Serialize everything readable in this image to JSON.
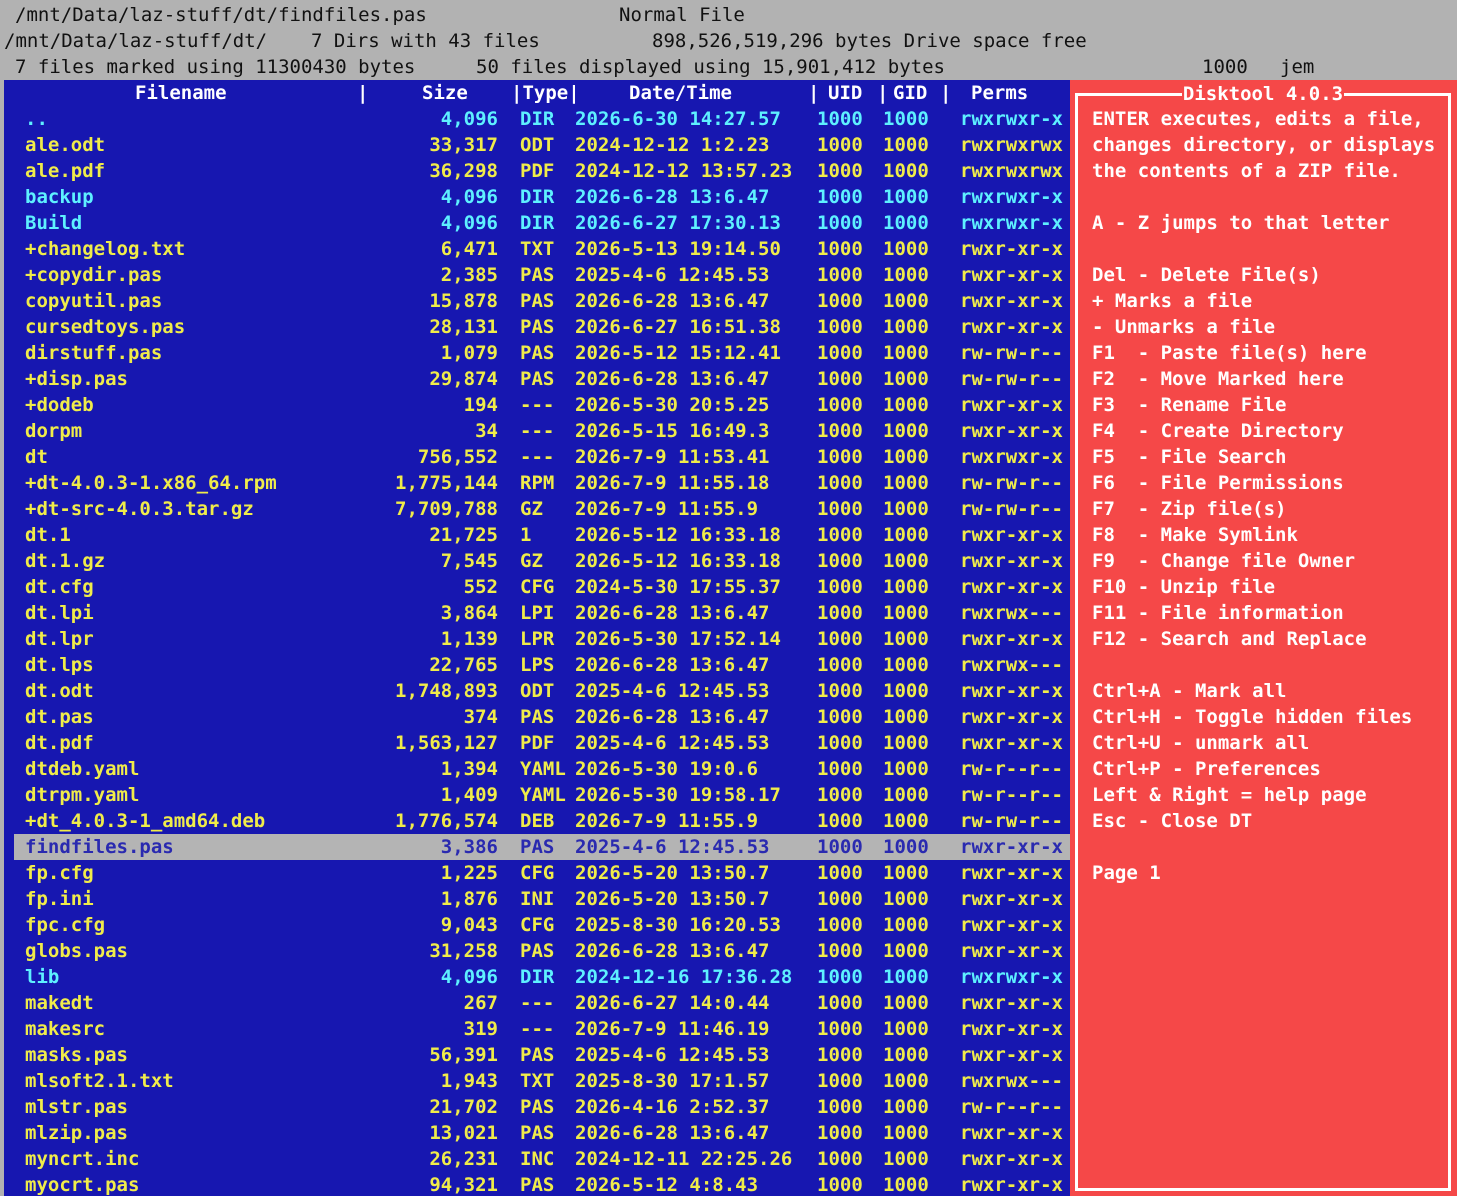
{
  "status": {
    "line1_path": "/mnt/Data/laz-stuff/dt/findfiles.pas",
    "line1_kind": "Normal File",
    "line2_dir": "/mnt/Data/laz-stuff/dt/",
    "line2_counts": "7 Dirs with 43 files",
    "line2_free": "898,526,519,296 bytes Drive space free",
    "line3_marked": "7 files marked using 11300430 bytes",
    "line3_displayed": "50 files displayed using 15,901,412 bytes",
    "line3_uid": "1000",
    "line3_user": "jem"
  },
  "columns": {
    "filename": "Filename",
    "sep1": "|",
    "size": "Size",
    "type": "|Type|",
    "datetime": "Date/Time",
    "sep2": "|",
    "uid": "UID",
    "sep3": "|",
    "gid": "GID",
    "sep4": "|",
    "perms": "Perms"
  },
  "files": [
    {
      "name": "..",
      "size": "4,096",
      "type": "DIR",
      "date": "2026-6-30 14:27.57",
      "uid": "1000",
      "gid": "1000",
      "perms": "rwxrwxr-x",
      "kind": "dir"
    },
    {
      "name": "ale.odt",
      "size": "33,317",
      "type": "ODT",
      "date": "2024-12-12 1:2.23",
      "uid": "1000",
      "gid": "1000",
      "perms": "rwxrwxrwx",
      "kind": "file"
    },
    {
      "name": "ale.pdf",
      "size": "36,298",
      "type": "PDF",
      "date": "2024-12-12 13:57.23",
      "uid": "1000",
      "gid": "1000",
      "perms": "rwxrwxrwx",
      "kind": "file"
    },
    {
      "name": "backup",
      "size": "4,096",
      "type": "DIR",
      "date": "2026-6-28 13:6.47",
      "uid": "1000",
      "gid": "1000",
      "perms": "rwxrwxr-x",
      "kind": "dir"
    },
    {
      "name": "Build",
      "size": "4,096",
      "type": "DIR",
      "date": "2026-6-27 17:30.13",
      "uid": "1000",
      "gid": "1000",
      "perms": "rwxrwxr-x",
      "kind": "dir"
    },
    {
      "name": "+changelog.txt",
      "size": "6,471",
      "type": "TXT",
      "date": "2026-5-13 19:14.50",
      "uid": "1000",
      "gid": "1000",
      "perms": "rwxr-xr-x",
      "kind": "file"
    },
    {
      "name": "+copydir.pas",
      "size": "2,385",
      "type": "PAS",
      "date": "2025-4-6 12:45.53",
      "uid": "1000",
      "gid": "1000",
      "perms": "rwxr-xr-x",
      "kind": "file"
    },
    {
      "name": "copyutil.pas",
      "size": "15,878",
      "type": "PAS",
      "date": "2026-6-28 13:6.47",
      "uid": "1000",
      "gid": "1000",
      "perms": "rwxr-xr-x",
      "kind": "file"
    },
    {
      "name": "cursedtoys.pas",
      "size": "28,131",
      "type": "PAS",
      "date": "2026-6-27 16:51.38",
      "uid": "1000",
      "gid": "1000",
      "perms": "rwxr-xr-x",
      "kind": "file"
    },
    {
      "name": "dirstuff.pas",
      "size": "1,079",
      "type": "PAS",
      "date": "2026-5-12 15:12.41",
      "uid": "1000",
      "gid": "1000",
      "perms": "rw-rw-r--",
      "kind": "file"
    },
    {
      "name": "+disp.pas",
      "size": "29,874",
      "type": "PAS",
      "date": "2026-6-28 13:6.47",
      "uid": "1000",
      "gid": "1000",
      "perms": "rw-rw-r--",
      "kind": "file"
    },
    {
      "name": "+dodeb",
      "size": "194",
      "type": "---",
      "date": "2026-5-30 20:5.25",
      "uid": "1000",
      "gid": "1000",
      "perms": "rwxr-xr-x",
      "kind": "file"
    },
    {
      "name": "dorpm",
      "size": "34",
      "type": "---",
      "date": "2026-5-15 16:49.3",
      "uid": "1000",
      "gid": "1000",
      "perms": "rwxr-xr-x",
      "kind": "file"
    },
    {
      "name": "dt",
      "size": "756,552",
      "type": "---",
      "date": "2026-7-9 11:53.41",
      "uid": "1000",
      "gid": "1000",
      "perms": "rwxrwxr-x",
      "kind": "file"
    },
    {
      "name": "+dt-4.0.3-1.x86_64.rpm",
      "size": "1,775,144",
      "type": "RPM",
      "date": "2026-7-9 11:55.18",
      "uid": "1000",
      "gid": "1000",
      "perms": "rw-rw-r--",
      "kind": "file"
    },
    {
      "name": "+dt-src-4.0.3.tar.gz",
      "size": "7,709,788",
      "type": "GZ",
      "date": "2026-7-9 11:55.9",
      "uid": "1000",
      "gid": "1000",
      "perms": "rw-rw-r--",
      "kind": "file"
    },
    {
      "name": "dt.1",
      "size": "21,725",
      "type": "1",
      "date": "2026-5-12 16:33.18",
      "uid": "1000",
      "gid": "1000",
      "perms": "rwxr-xr-x",
      "kind": "file"
    },
    {
      "name": "dt.1.gz",
      "size": "7,545",
      "type": "GZ",
      "date": "2026-5-12 16:33.18",
      "uid": "1000",
      "gid": "1000",
      "perms": "rwxr-xr-x",
      "kind": "file"
    },
    {
      "name": "dt.cfg",
      "size": "552",
      "type": "CFG",
      "date": "2024-5-30 17:55.37",
      "uid": "1000",
      "gid": "1000",
      "perms": "rwxr-xr-x",
      "kind": "file"
    },
    {
      "name": "dt.lpi",
      "size": "3,864",
      "type": "LPI",
      "date": "2026-6-28 13:6.47",
      "uid": "1000",
      "gid": "1000",
      "perms": "rwxrwx---",
      "kind": "file"
    },
    {
      "name": "dt.lpr",
      "size": "1,139",
      "type": "LPR",
      "date": "2026-5-30 17:52.14",
      "uid": "1000",
      "gid": "1000",
      "perms": "rwxr-xr-x",
      "kind": "file"
    },
    {
      "name": "dt.lps",
      "size": "22,765",
      "type": "LPS",
      "date": "2026-6-28 13:6.47",
      "uid": "1000",
      "gid": "1000",
      "perms": "rwxrwx---",
      "kind": "file"
    },
    {
      "name": "dt.odt",
      "size": "1,748,893",
      "type": "ODT",
      "date": "2025-4-6 12:45.53",
      "uid": "1000",
      "gid": "1000",
      "perms": "rwxr-xr-x",
      "kind": "file"
    },
    {
      "name": "dt.pas",
      "size": "374",
      "type": "PAS",
      "date": "2026-6-28 13:6.47",
      "uid": "1000",
      "gid": "1000",
      "perms": "rwxr-xr-x",
      "kind": "file"
    },
    {
      "name": "dt.pdf",
      "size": "1,563,127",
      "type": "PDF",
      "date": "2025-4-6 12:45.53",
      "uid": "1000",
      "gid": "1000",
      "perms": "rwxr-xr-x",
      "kind": "file"
    },
    {
      "name": "dtdeb.yaml",
      "size": "1,394",
      "type": "YAML",
      "date": "2026-5-30 19:0.6",
      "uid": "1000",
      "gid": "1000",
      "perms": "rw-r--r--",
      "kind": "file"
    },
    {
      "name": "dtrpm.yaml",
      "size": "1,409",
      "type": "YAML",
      "date": "2026-5-30 19:58.17",
      "uid": "1000",
      "gid": "1000",
      "perms": "rw-r--r--",
      "kind": "file"
    },
    {
      "name": "+dt_4.0.3-1_amd64.deb",
      "size": "1,776,574",
      "type": "DEB",
      "date": "2026-7-9 11:55.9",
      "uid": "1000",
      "gid": "1000",
      "perms": "rw-rw-r--",
      "kind": "file"
    },
    {
      "name": "findfiles.pas",
      "size": "3,386",
      "type": "PAS",
      "date": "2025-4-6 12:45.53",
      "uid": "1000",
      "gid": "1000",
      "perms": "rwxr-xr-x",
      "kind": "selected"
    },
    {
      "name": "fp.cfg",
      "size": "1,225",
      "type": "CFG",
      "date": "2026-5-20 13:50.7",
      "uid": "1000",
      "gid": "1000",
      "perms": "rwxr-xr-x",
      "kind": "file"
    },
    {
      "name": "fp.ini",
      "size": "1,876",
      "type": "INI",
      "date": "2026-5-20 13:50.7",
      "uid": "1000",
      "gid": "1000",
      "perms": "rwxr-xr-x",
      "kind": "file"
    },
    {
      "name": "fpc.cfg",
      "size": "9,043",
      "type": "CFG",
      "date": "2025-8-30 16:20.53",
      "uid": "1000",
      "gid": "1000",
      "perms": "rwxr-xr-x",
      "kind": "file"
    },
    {
      "name": "globs.pas",
      "size": "31,258",
      "type": "PAS",
      "date": "2026-6-28 13:6.47",
      "uid": "1000",
      "gid": "1000",
      "perms": "rwxr-xr-x",
      "kind": "file"
    },
    {
      "name": "lib",
      "size": "4,096",
      "type": "DIR",
      "date": "2024-12-16 17:36.28",
      "uid": "1000",
      "gid": "1000",
      "perms": "rwxrwxr-x",
      "kind": "dir"
    },
    {
      "name": "makedt",
      "size": "267",
      "type": "---",
      "date": "2026-6-27 14:0.44",
      "uid": "1000",
      "gid": "1000",
      "perms": "rwxr-xr-x",
      "kind": "file"
    },
    {
      "name": "makesrc",
      "size": "319",
      "type": "---",
      "date": "2026-7-9 11:46.19",
      "uid": "1000",
      "gid": "1000",
      "perms": "rwxr-xr-x",
      "kind": "file"
    },
    {
      "name": "masks.pas",
      "size": "56,391",
      "type": "PAS",
      "date": "2025-4-6 12:45.53",
      "uid": "1000",
      "gid": "1000",
      "perms": "rwxr-xr-x",
      "kind": "file"
    },
    {
      "name": "mlsoft2.1.txt",
      "size": "1,943",
      "type": "TXT",
      "date": "2025-8-30 17:1.57",
      "uid": "1000",
      "gid": "1000",
      "perms": "rwxrwx---",
      "kind": "file"
    },
    {
      "name": "mlstr.pas",
      "size": "21,702",
      "type": "PAS",
      "date": "2026-4-16 2:52.37",
      "uid": "1000",
      "gid": "1000",
      "perms": "rw-r--r--",
      "kind": "file"
    },
    {
      "name": "mlzip.pas",
      "size": "13,021",
      "type": "PAS",
      "date": "2026-6-28 13:6.47",
      "uid": "1000",
      "gid": "1000",
      "perms": "rwxr-xr-x",
      "kind": "file"
    },
    {
      "name": "myncrt.inc",
      "size": "26,231",
      "type": "INC",
      "date": "2024-12-11 22:25.26",
      "uid": "1000",
      "gid": "1000",
      "perms": "rwxr-xr-x",
      "kind": "file"
    },
    {
      "name": "myocrt.pas",
      "size": "94,321",
      "type": "PAS",
      "date": "2026-5-12 4:8.43",
      "uid": "1000",
      "gid": "1000",
      "perms": "rwxr-xr-x",
      "kind": "file"
    }
  ],
  "help": {
    "title": "Disktool 4.0.3",
    "lines": [
      "ENTER executes, edits a file,",
      "changes directory, or displays",
      "the contents of a ZIP file.",
      "",
      "A - Z jumps to that letter",
      "",
      "Del - Delete File(s)",
      "+ Marks a file",
      "- Unmarks a file",
      "F1  - Paste file(s) here",
      "F2  - Move Marked here",
      "F3  - Rename File",
      "F4  - Create Directory",
      "F5  - File Search",
      "F6  - File Permissions",
      "F7  - Zip file(s)",
      "F8  - Make Symlink",
      "F9  - Change file Owner",
      "F10 - Unzip file",
      "F11 - File information",
      "F12 - Search and Replace",
      "",
      "Ctrl+A - Mark all",
      "Ctrl+H - Toggle hidden files",
      "Ctrl+U - unmark all",
      "Ctrl+P - Preferences",
      "Left & Right = help page",
      "Esc - Close DT",
      "",
      "Page 1"
    ]
  },
  "colors": {
    "status_bg": "#b2b2b2",
    "list_bg": "#1717b0",
    "file_text": "#f0ec4a",
    "dir_text": "#5ef0ff",
    "selected_bg": "#b4b4b4",
    "help_bg": "#f54848"
  }
}
